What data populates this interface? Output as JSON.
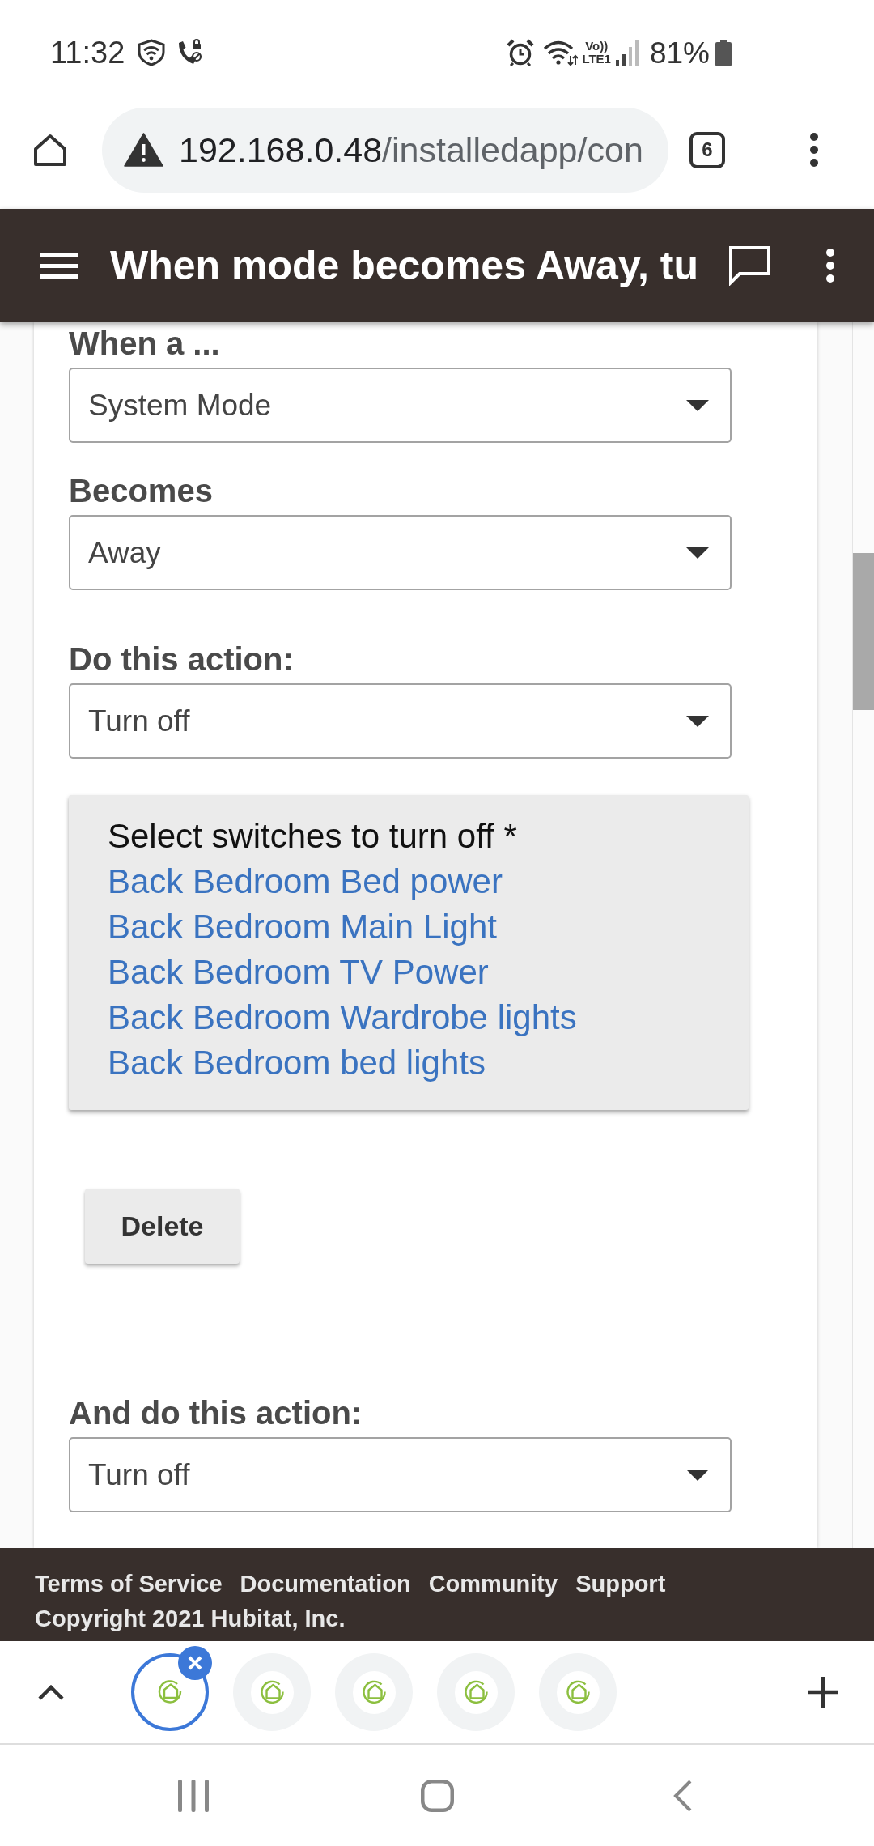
{
  "status_bar": {
    "time": "11:32",
    "network_type": [
      "Vo))",
      "LTE1"
    ],
    "battery": "81%"
  },
  "browser": {
    "url_host": "192.168.0.48",
    "url_path": "/installedapp/con",
    "tab_count": "6"
  },
  "app_bar": {
    "title": "When mode becomes Away, tu"
  },
  "form": [
    {
      "kind": "select",
      "label": "When a ...",
      "value": "System Mode"
    },
    {
      "kind": "select",
      "label": "Becomes",
      "value": "Away"
    },
    {
      "kind": "select",
      "label": "Do this action:",
      "value": "Turn off"
    },
    {
      "kind": "device_list",
      "title": "Select switches to turn off *",
      "devices": [
        "Back Bedroom Bed power",
        "Back Bedroom Main Light",
        "Back Bedroom TV Power",
        "Back Bedroom Wardrobe lights",
        "Back Bedroom bed lights"
      ]
    },
    {
      "kind": "button",
      "label": "Delete"
    },
    {
      "kind": "select",
      "label": "And do this action:",
      "value": "Turn off"
    }
  ],
  "footer": {
    "links": [
      "Terms of Service",
      "Documentation",
      "Community",
      "Support"
    ],
    "copyright": "Copyright 2021 Hubitat, Inc."
  },
  "tab_strip": {
    "tabs": [
      {
        "selected": true
      },
      {
        "selected": false
      },
      {
        "selected": false
      },
      {
        "selected": false
      },
      {
        "selected": false
      }
    ]
  }
}
